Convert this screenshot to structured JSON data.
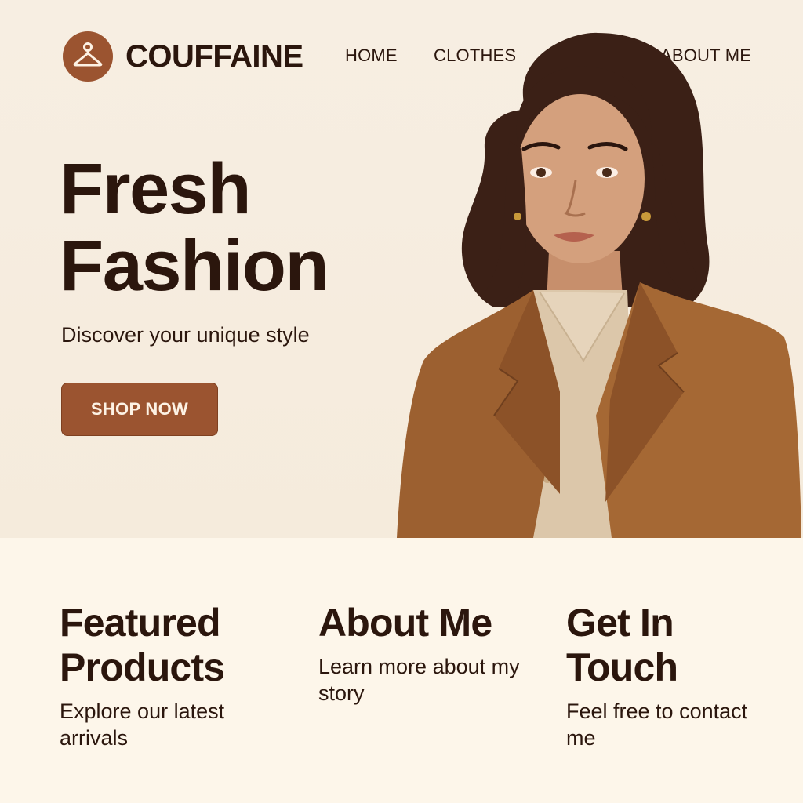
{
  "header": {
    "brand": "COUFFAINE",
    "logo_icon": "hanger-icon",
    "nav": [
      {
        "label": "HOME"
      },
      {
        "label": "CLOTHES"
      },
      {
        "label": "ABOUT ME"
      }
    ]
  },
  "hero": {
    "title_line1": "Fresh",
    "title_line2": "Fashion",
    "subtitle": "Discover your unique style",
    "cta_label": "SHOP NOW"
  },
  "sections": [
    {
      "title_line1": "Featured",
      "title_line2": "Products",
      "text": "Explore our latest arrivals"
    },
    {
      "title_line1": "About Me",
      "title_line2": "",
      "text": "Learn more about my story"
    },
    {
      "title_line1": "Get In",
      "title_line2": "Touch",
      "text": "Feel free to contact me"
    }
  ],
  "colors": {
    "accent": "#9b5430",
    "text": "#2b160d",
    "hero_bg": "#f6ecdf",
    "page_bg": "#fdf6ea"
  }
}
